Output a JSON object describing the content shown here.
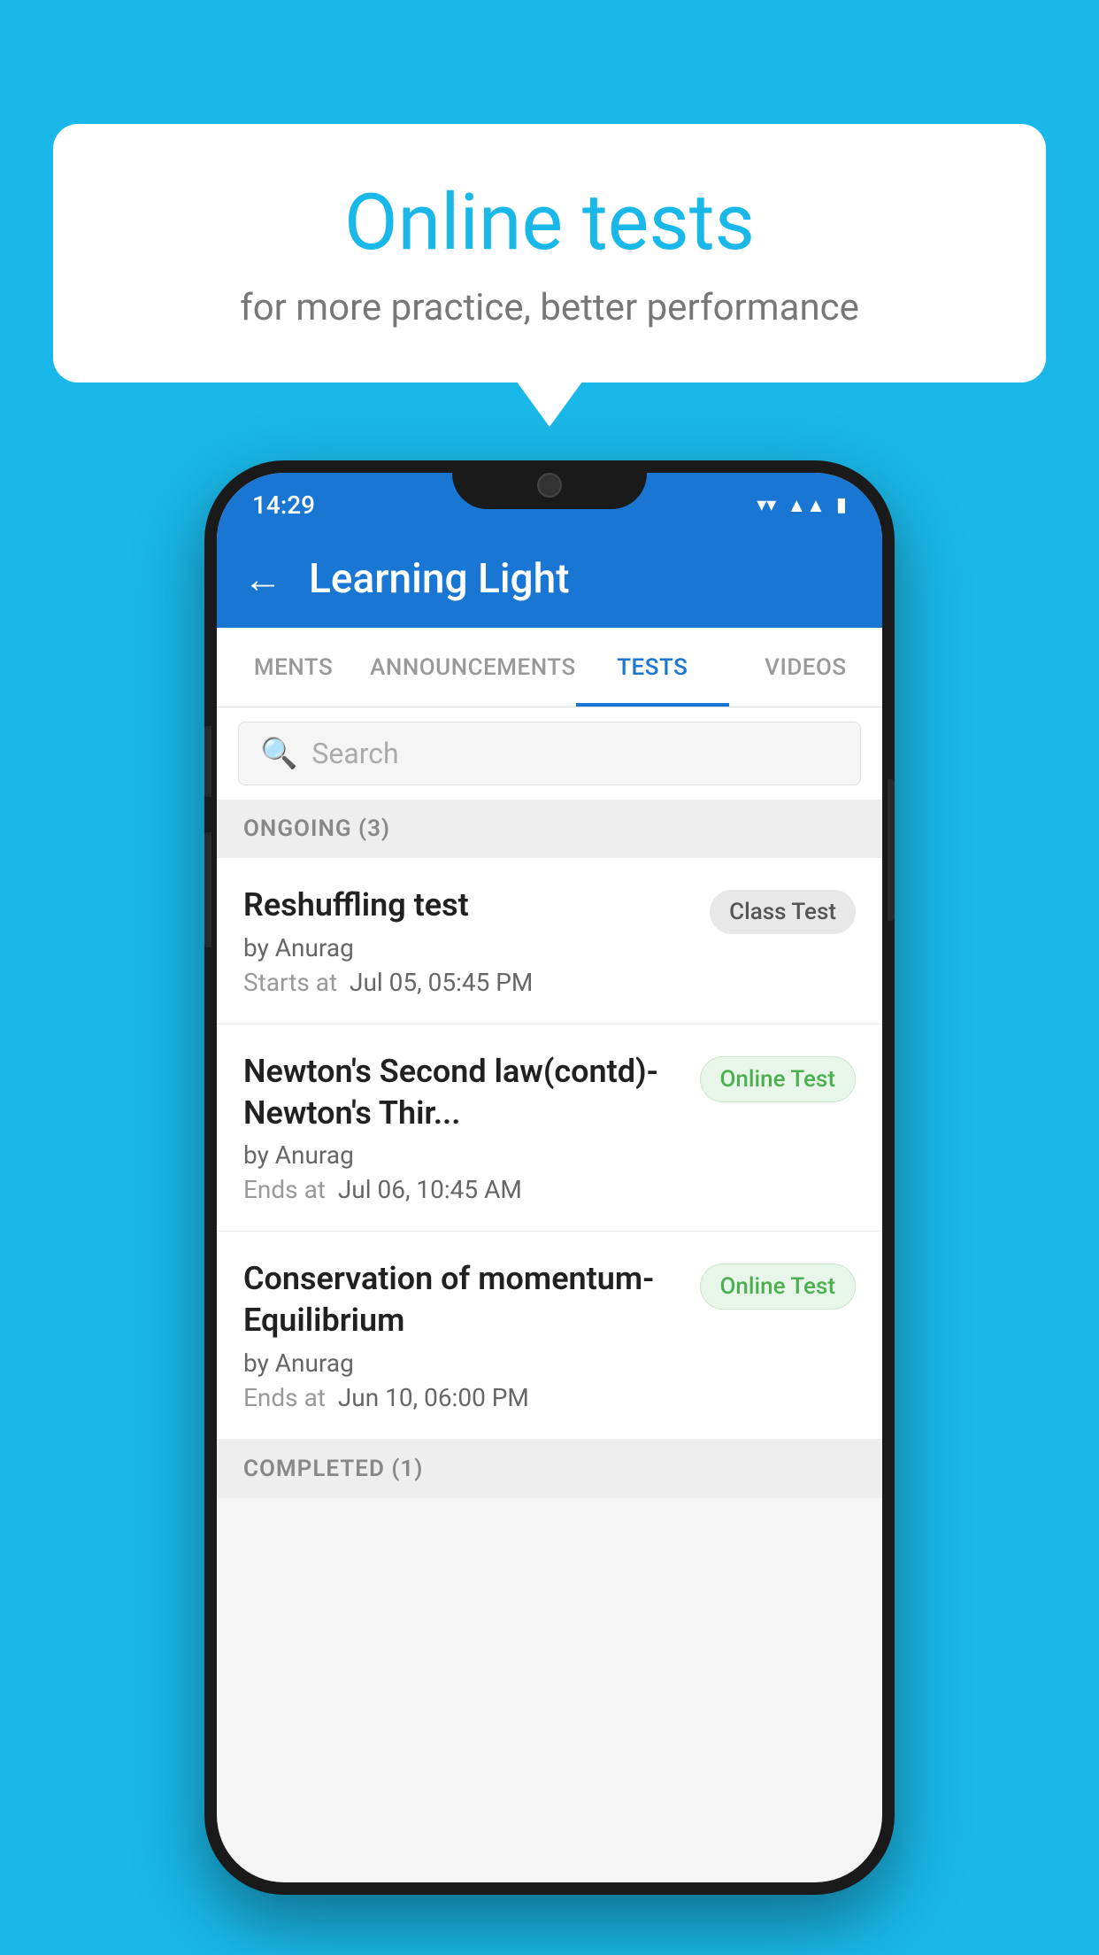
{
  "background": {
    "color": "#1ab8e8"
  },
  "bubble": {
    "title": "Online tests",
    "subtitle": "for more practice, better performance"
  },
  "status_bar": {
    "time": "14:29",
    "wifi_icon": "▾",
    "signal_icon": "▲",
    "battery_icon": "▮"
  },
  "app_bar": {
    "back_icon": "←",
    "title": "Learning Light"
  },
  "tabs": [
    {
      "label": "MENTS",
      "active": false
    },
    {
      "label": "ANNOUNCEMENTS",
      "active": false
    },
    {
      "label": "TESTS",
      "active": true
    },
    {
      "label": "VIDEOS",
      "active": false
    }
  ],
  "search": {
    "placeholder": "Search",
    "icon": "🔍"
  },
  "ongoing_section": {
    "label": "ONGOING (3)"
  },
  "tests": [
    {
      "name": "Reshuffling test",
      "author": "by Anurag",
      "time_label": "Starts at",
      "time": "Jul 05, 05:45 PM",
      "badge": "Class Test",
      "badge_type": "class"
    },
    {
      "name": "Newton's Second law(contd)-Newton's Thir...",
      "author": "by Anurag",
      "time_label": "Ends at",
      "time": "Jul 06, 10:45 AM",
      "badge": "Online Test",
      "badge_type": "online"
    },
    {
      "name": "Conservation of momentum-Equilibrium",
      "author": "by Anurag",
      "time_label": "Ends at",
      "time": "Jun 10, 06:00 PM",
      "badge": "Online Test",
      "badge_type": "online"
    }
  ],
  "completed_section": {
    "label": "COMPLETED (1)"
  }
}
